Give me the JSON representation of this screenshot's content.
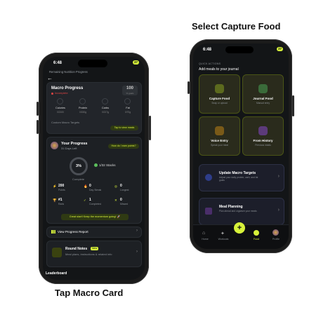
{
  "captions": {
    "right": "Select Capture Food",
    "left": "Tap Macro Card"
  },
  "left": {
    "status": {
      "time": "6:48",
      "battery": "37"
    },
    "header": {
      "title": "Remaining Nutrition Progress"
    },
    "macro": {
      "title": "Macro Progress",
      "status": "Incomplete",
      "total_value": "100",
      "total_label": "% goals",
      "items": [
        {
          "label": "Calories",
          "value": "0/2100"
        },
        {
          "label": "Protein",
          "value": "0/150g"
        },
        {
          "label": "Carbs",
          "value": "0/217g"
        },
        {
          "label": "Fat",
          "value": "0/70g"
        }
      ],
      "custom": "Custom Macro Targets",
      "tap": "Tap to view meals"
    },
    "progress": {
      "title": "Your Progress",
      "days": "31 Days Left",
      "earn": "How do I earn points?",
      "percent": "3%",
      "complete": "Complete",
      "stacks": "1/32 Stacks",
      "stats": [
        {
          "num": "200",
          "lbl": "Points"
        },
        {
          "num": "0",
          "lbl": "Day Streak"
        },
        {
          "num": "0",
          "lbl": "Longest"
        },
        {
          "num": "#1",
          "lbl": "Rank"
        },
        {
          "num": "1",
          "lbl": "Completed"
        },
        {
          "num": "0",
          "lbl": "Missed"
        }
      ],
      "message": "Great start! Keep the momentum going! 🚀"
    },
    "report": "View Progress Report",
    "round": {
      "title": "Round Notes",
      "badge": "New",
      "sub": "Meal plans, instructions & related info"
    },
    "bottom": "Leaderboard"
  },
  "right": {
    "status": {
      "time": "6:48",
      "battery": "37"
    },
    "section": "QUICK ACTIONS",
    "subtitle": "Add meals to your journal",
    "actions": [
      {
        "title": "Capture Food",
        "sub": "Snap or upload",
        "icon": "camera-icon",
        "color": "#5c6a1e"
      },
      {
        "title": "Journal Food",
        "sub": "Manual entry",
        "icon": "journal-icon",
        "color": "#3a6b3a"
      },
      {
        "title": "Voice Entry",
        "sub": "Speak your meal",
        "icon": "microphone-icon",
        "color": "#7a5a18"
      },
      {
        "title": "From History",
        "sub": "Previous meals",
        "icon": "history-icon",
        "color": "#5c3a7a"
      }
    ],
    "macro_targets": {
      "title": "Update Macro Targets",
      "sub": "Adjust your daily protein, carb, and fat goals"
    },
    "meal_planning": {
      "title": "Meal Planning",
      "sub": "Plan ahead and organize your meals"
    },
    "nav": [
      {
        "label": "Home"
      },
      {
        "label": "Workouts"
      },
      {
        "label": ""
      },
      {
        "label": "Food"
      },
      {
        "label": "Profile"
      }
    ]
  }
}
